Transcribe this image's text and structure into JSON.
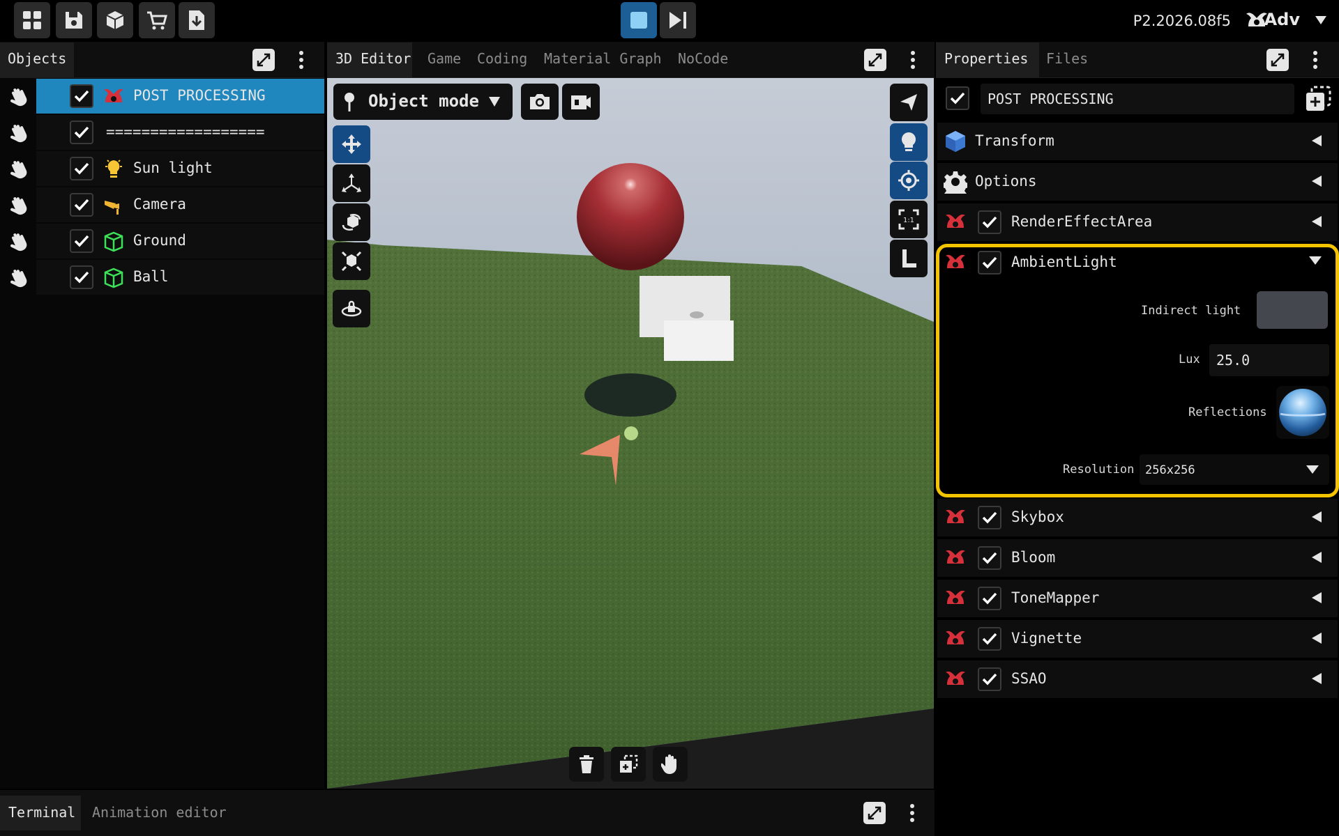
{
  "toolbar": {
    "icons": [
      "grid-icon",
      "save-icon",
      "cube-icon",
      "cart-icon",
      "download-icon"
    ],
    "play_controls": [
      "stop-icon",
      "step-forward-icon"
    ],
    "version": "P2.2026.08f5",
    "mode_label": "Adv"
  },
  "objects_panel": {
    "title": "Objects",
    "items": [
      {
        "label": "POST PROCESSING",
        "icon": "post-processing-icon",
        "checked": true,
        "selected": true
      },
      {
        "label": "==================",
        "icon": "",
        "checked": true,
        "selected": false
      },
      {
        "label": "Sun light",
        "icon": "bulb-icon",
        "checked": true,
        "selected": false
      },
      {
        "label": "Camera",
        "icon": "camera-icon",
        "checked": true,
        "selected": false
      },
      {
        "label": "Ground",
        "icon": "mesh-icon",
        "checked": true,
        "selected": false
      },
      {
        "label": "Ball",
        "icon": "mesh-icon",
        "checked": true,
        "selected": false
      }
    ]
  },
  "editor": {
    "tabs": [
      "3D Editor",
      "Game",
      "Coding",
      "Material Graph",
      "NoCode"
    ],
    "active_tab": "3D Editor",
    "mode_select": "Object mode"
  },
  "properties": {
    "tabs": [
      "Properties",
      "Files"
    ],
    "object_name": "POST PROCESSING",
    "sections": [
      {
        "label": "Transform",
        "icon": "cube-icon"
      },
      {
        "label": "Options",
        "icon": "gear-icon"
      }
    ],
    "components": [
      {
        "label": "RenderEffectArea",
        "checked": true,
        "expanded": false
      },
      {
        "label": "AmbientLight",
        "checked": true,
        "expanded": true
      },
      {
        "label": "Skybox",
        "checked": true,
        "expanded": false
      },
      {
        "label": "Bloom",
        "checked": true,
        "expanded": false
      },
      {
        "label": "ToneMapper",
        "checked": true,
        "expanded": false
      },
      {
        "label": "Vignette",
        "checked": true,
        "expanded": false
      },
      {
        "label": "SSAO",
        "checked": true,
        "expanded": false
      }
    ],
    "ambient": {
      "indirect_light_label": "Indirect light",
      "indirect_light_color": "#45474e",
      "lux_label": "Lux",
      "lux_value": "25.0",
      "reflections_label": "Reflections",
      "resolution_label": "Resolution",
      "resolution_value": "256x256"
    },
    "highlight_color": "#f5c400"
  },
  "bottom_panel": {
    "tabs": [
      "Terminal",
      "Animation editor"
    ],
    "active_tab": "Terminal"
  }
}
